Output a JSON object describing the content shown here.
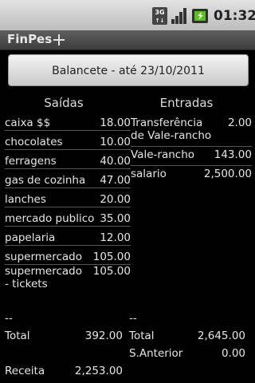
{
  "status_bar": {
    "network_label": "3G",
    "time": "01:32",
    "icons": [
      "3g-icon",
      "signal-icon",
      "battery-icon"
    ]
  },
  "app": {
    "title": "FinPes"
  },
  "balance_button": {
    "label": "Balancete - até 23/10/2011"
  },
  "columns": {
    "left_title": "Saídas",
    "right_title": "Entradas"
  },
  "saidas": [
    {
      "label": "caixa $$",
      "value": "18.00"
    },
    {
      "label": "chocolates",
      "value": "10.00"
    },
    {
      "label": "ferragens",
      "value": "40.00"
    },
    {
      "label": "gas de cozinha",
      "value": "47.00"
    },
    {
      "label": "lanches",
      "value": "20.00"
    },
    {
      "label": "mercado publico",
      "value": "35.00"
    },
    {
      "label": "papelaria",
      "value": "12.00"
    },
    {
      "label": "supermercado",
      "value": "105.00"
    },
    {
      "label": "supermercado - tickets",
      "value": "105.00"
    }
  ],
  "entradas": [
    {
      "label": "Transferência de Vale-rancho",
      "value": "2.00"
    },
    {
      "label": "Vale-rancho",
      "value": "143.00"
    },
    {
      "label": "salario",
      "value": "2,500.00"
    }
  ],
  "summary": {
    "left_separator": "--",
    "right_separator": "--",
    "left_total_label": "Total",
    "left_total_value": "392.00",
    "right_total_label": "Total",
    "right_total_value": "2,645.00",
    "s_anterior_label": "S.Anterior",
    "s_anterior_value": "0.00",
    "receita_label": "Receita",
    "receita_value": "2,253.00"
  },
  "colors": {
    "background": "#000000",
    "text": "#e6e6e6",
    "divider": "#555555",
    "button_top": "#f4f4f4",
    "button_bottom": "#c9c9c9"
  }
}
